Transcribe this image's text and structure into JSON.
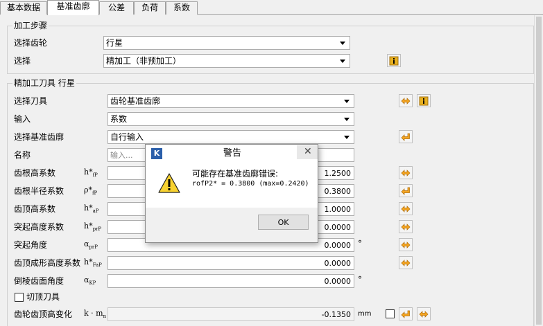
{
  "tabs": [
    "基本数据",
    "基准齿廓",
    "公差",
    "负荷",
    "系数"
  ],
  "section_process": {
    "title": "加工步骤",
    "select_gear_label": "选择齿轮",
    "select_gear_value": "行星",
    "select_label": "选择",
    "select_value": "精加工（非预加工）"
  },
  "section_tool": {
    "title": "精加工刀具 行星",
    "tool_label": "选择刀具",
    "tool_value": "齿轮基准齿廓",
    "input_label": "输入",
    "input_value": "系数",
    "ref_label": "选择基准齿廓",
    "ref_value": "自行输入",
    "name_label": "名称",
    "name_placeholder": "输入...",
    "rows": [
      {
        "label": "齿根高系数",
        "sym": "h*",
        "sub": "fP",
        "value": "1.2500",
        "unit": ""
      },
      {
        "label": "齿根半径系数",
        "sym": "ρ*",
        "sub": "fP",
        "value": "0.3800",
        "unit": ""
      },
      {
        "label": "齿顶高系数",
        "sym": "h*",
        "sub": "aP",
        "value": "1.0000",
        "unit": ""
      },
      {
        "label": "突起高度系数",
        "sym": "h*",
        "sub": "prP",
        "value": "0.0000",
        "unit": ""
      },
      {
        "label": "突起角度",
        "sym": "α",
        "sub": "prP",
        "value": "0.0000",
        "unit": "°"
      },
      {
        "label": "齿顶成形高度系数",
        "sym": "h*",
        "sub": "FaP",
        "value": "0.0000",
        "unit": ""
      },
      {
        "label": "倒棱齿面角度",
        "sym": "α",
        "sub": "KP",
        "value": "0.0000",
        "unit": "°"
      }
    ],
    "tip_relief_label": "切顶刀具",
    "tip_change_label": "齿轮齿顶高变化",
    "tip_change_sym": "k · m",
    "tip_change_sub": "n",
    "tip_change_value": "-0.1350",
    "tip_change_unit": "mm"
  },
  "dialog": {
    "logo": "K",
    "title": "警告",
    "message_line1": "可能存在基准齿廓错误:",
    "message_line2": "rofP2* = 0.3800 (max=0.2420)",
    "ok_label": "OK",
    "close_glyph": "✕"
  },
  "colors": {
    "arrow_button": "#f5a623",
    "info_button": "#e8b020",
    "warning_fill": "#f8d230"
  },
  "icons": [
    "arrows-both-icon",
    "info-icon",
    "arrow-left-icon",
    "warning-icon"
  ]
}
